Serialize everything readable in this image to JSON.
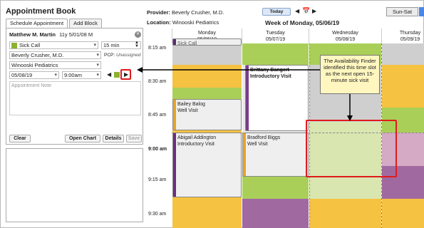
{
  "panel": {
    "title": "Appointment Book",
    "tabs": [
      "Schedule Appointment",
      "Add Block"
    ],
    "patient": "Matthew M. Martin",
    "patient_info": "11y 5/01/08 M",
    "visit_type": "Sick Call",
    "duration": "15 min",
    "provider": "Beverly Crusher, M.D.",
    "pcp_label": "PCP:",
    "pcp_value": "Unassigned",
    "location": "Winooski Pediatrics",
    "date": "05/08/19",
    "time": "9:00am",
    "note_placeholder": "Appointment Note",
    "buttons": {
      "clear": "Clear",
      "open_chart": "Open Chart",
      "details": "Details",
      "save": "Save"
    }
  },
  "header": {
    "provider_label": "Provider:",
    "provider_value": "Beverly Crusher, M.D.",
    "location_label": "Location:",
    "location_value": "Winooski Pediatrics",
    "today": "Today",
    "week_title": "Week of Monday, 05/06/19",
    "range_button": "Sun-Sat"
  },
  "calendar": {
    "days": [
      {
        "name": "Monday",
        "date": "05/06/19"
      },
      {
        "name": "Tuesday",
        "date": "05/07/19"
      },
      {
        "name": "Wednesday",
        "date": "05/08/19"
      },
      {
        "name": "Thursday",
        "date": "05/09/19"
      }
    ],
    "times": [
      "8:15 am",
      "8:30 am",
      "8:45 am",
      "9:00 am",
      "9:15 am",
      "9:30 am"
    ],
    "appointments": [
      {
        "name": "Sick Call",
        "type": ""
      },
      {
        "name": "Brittany Bangert",
        "type": "Introductory Visit"
      },
      {
        "name": "Bailey Balog",
        "type": "Well Visit"
      },
      {
        "name": "Abigail Addington",
        "type": "Introductory Visit"
      },
      {
        "name": "Bradford Biggs",
        "type": "Well Visit"
      }
    ]
  },
  "callout": "The Availability Finder identified this time slot as the next open 15-minute sick visit",
  "colors": {
    "yellow": "#f5c242",
    "green": "#aacf58",
    "purple": "#a06aa0",
    "light_green": "#d9e6b0",
    "red": "#e01b1b",
    "gray": "#cfcfcf"
  }
}
